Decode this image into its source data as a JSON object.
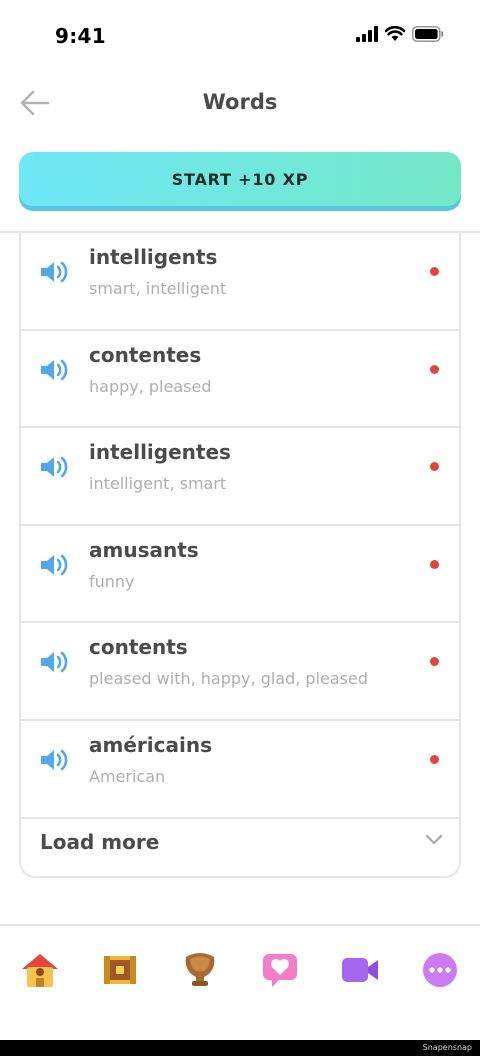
{
  "status_bar": {
    "time": "9:41"
  },
  "header": {
    "title": "Words"
  },
  "start_button": {
    "label": "START +10 XP"
  },
  "words": [
    {
      "term": "intelligents",
      "definition": "smart, intelligent"
    },
    {
      "term": "contentes",
      "definition": "happy, pleased"
    },
    {
      "term": "intelligentes",
      "definition": "intelligent, smart"
    },
    {
      "term": "amusants",
      "definition": "funny"
    },
    {
      "term": "contents",
      "definition": "pleased with, happy, glad, pleased"
    },
    {
      "term": "américains",
      "definition": "American"
    }
  ],
  "load_more": {
    "label": "Load more"
  },
  "tabs": [
    {
      "icon": "home-icon"
    },
    {
      "icon": "treasure-chest-icon"
    },
    {
      "icon": "trophy-icon"
    },
    {
      "icon": "heart-chat-icon"
    },
    {
      "icon": "video-icon"
    },
    {
      "icon": "more-icon"
    }
  ],
  "colors": {
    "accent_start": "#6ee7f7",
    "accent_end": "#74e8c6",
    "dot": "#e0463d",
    "speaker": "#52a8e8"
  },
  "footer": {
    "watermark": "Snapensnap"
  }
}
